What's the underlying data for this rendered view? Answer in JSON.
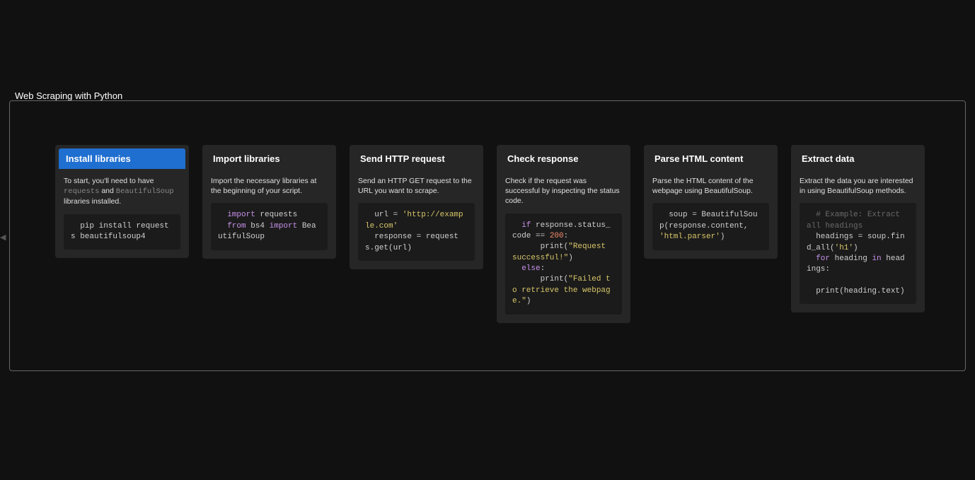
{
  "title": "Web Scraping with Python",
  "cards": [
    {
      "header": "Install libraries",
      "header_bg": "#1f6fd0",
      "desc_pre": "To start, you'll need to have ",
      "desc_code1": "requests",
      "desc_mid": " and ",
      "desc_code2": "BeautifulSoup",
      "desc_post": " libraries installed.",
      "code_plain": "  pip install requests beautifulsoup4"
    },
    {
      "header": "Import libraries",
      "header_bg": "#3a7a2f",
      "desc": "Import the necessary libraries at the beginning of your script.",
      "code_tokens": [
        {
          "t": "  ",
          "c": ""
        },
        {
          "t": "import",
          "c": "tok-kw"
        },
        {
          "t": " requests\n",
          "c": ""
        },
        {
          "t": "  ",
          "c": ""
        },
        {
          "t": "from",
          "c": "tok-kw"
        },
        {
          "t": " bs4 ",
          "c": ""
        },
        {
          "t": "import",
          "c": "tok-kw"
        },
        {
          "t": " BeautifulSoup",
          "c": ""
        }
      ]
    },
    {
      "header": "Send HTTP request",
      "header_bg": "#6a4acb",
      "desc": "Send an HTTP GET request to the URL you want to scrape.",
      "code_tokens": [
        {
          "t": "  url = ",
          "c": ""
        },
        {
          "t": "'http://example.com'",
          "c": "tok-str"
        },
        {
          "t": "\n",
          "c": ""
        },
        {
          "t": "  response = requests.get(url)",
          "c": ""
        }
      ]
    },
    {
      "header": "Check response",
      "header_bg": "#c75a2e",
      "desc": "Check if the request was successful by inspecting the status code.",
      "code_tokens": [
        {
          "t": "  ",
          "c": ""
        },
        {
          "t": "if",
          "c": "tok-kw"
        },
        {
          "t": " response.status_code == ",
          "c": ""
        },
        {
          "t": "200",
          "c": "tok-num"
        },
        {
          "t": ":\n",
          "c": ""
        },
        {
          "t": "      print(",
          "c": ""
        },
        {
          "t": "\"Request successful!\"",
          "c": "tok-str"
        },
        {
          "t": ")\n",
          "c": ""
        },
        {
          "t": "  ",
          "c": ""
        },
        {
          "t": "else",
          "c": "tok-kw"
        },
        {
          "t": ":\n",
          "c": ""
        },
        {
          "t": "      print(",
          "c": ""
        },
        {
          "t": "\"Failed to retrieve the webpage.\"",
          "c": "tok-str"
        },
        {
          "t": ")",
          "c": ""
        }
      ]
    },
    {
      "header": "Parse HTML content",
      "header_bg": "#8f7b25",
      "desc": "Parse the HTML content of the webpage using BeautifulSoup.",
      "code_tokens": [
        {
          "t": "  soup = BeautifulSoup(response.content, ",
          "c": ""
        },
        {
          "t": "'html.parser'",
          "c": "tok-str"
        },
        {
          "t": ")",
          "c": ""
        }
      ]
    },
    {
      "header": "Extract data",
      "header_bg": "#2e2e2e",
      "desc": "Extract the data you are interested in using BeautifulSoup methods.",
      "code_tokens": [
        {
          "t": "  ",
          "c": ""
        },
        {
          "t": "# Example: Extract all headings",
          "c": "tok-cmt"
        },
        {
          "t": "\n",
          "c": ""
        },
        {
          "t": "  headings = soup.find_all(",
          "c": ""
        },
        {
          "t": "'h1'",
          "c": "tok-str"
        },
        {
          "t": ")\n",
          "c": ""
        },
        {
          "t": "  ",
          "c": ""
        },
        {
          "t": "for",
          "c": "tok-kw"
        },
        {
          "t": " heading ",
          "c": ""
        },
        {
          "t": "in",
          "c": "tok-kw"
        },
        {
          "t": " headings:\n",
          "c": ""
        },
        {
          "t": "\n",
          "c": ""
        },
        {
          "t": "  print(heading.text)",
          "c": ""
        }
      ]
    }
  ]
}
